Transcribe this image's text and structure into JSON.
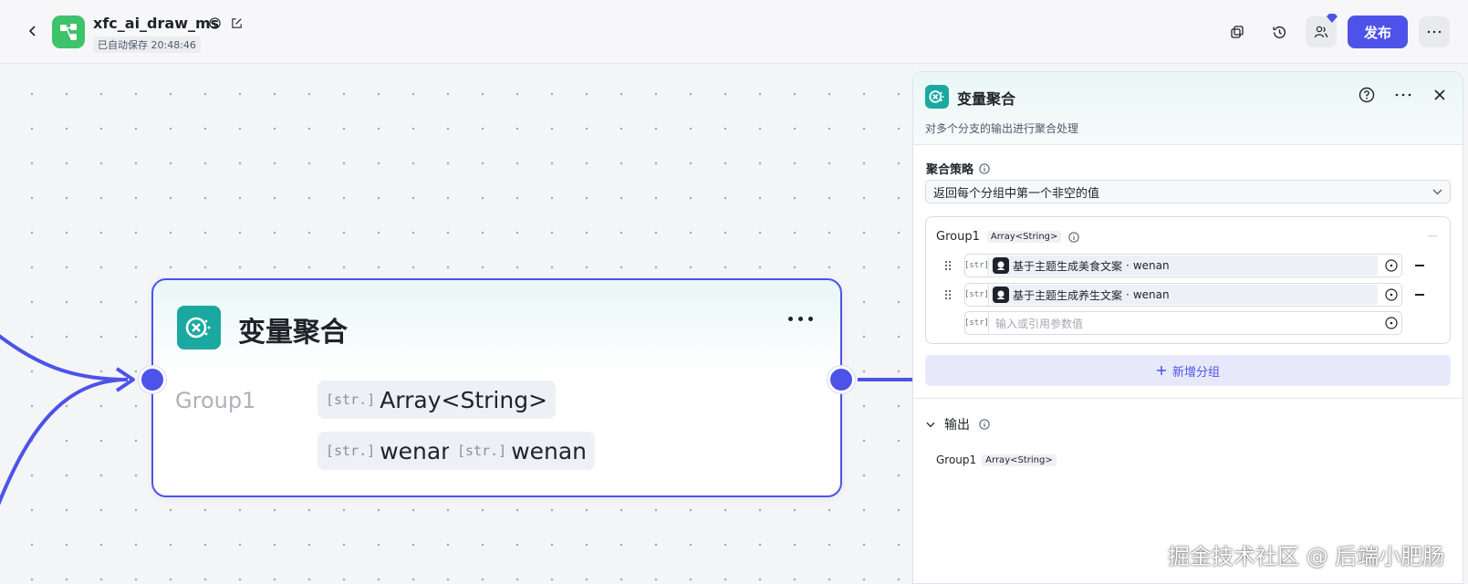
{
  "header": {
    "app_name": "xfc_ai_draw_ms",
    "save_status": "已自动保存 20:48:46",
    "publish_label": "发布",
    "brand_color": "#4d53e8",
    "logo_color": "#3ec26a"
  },
  "node": {
    "title": "变量聚合",
    "group_label": "Group1",
    "type_prefix": "[str.]",
    "type_label": "Array<String>",
    "vars": [
      "wenan",
      "wenan"
    ],
    "accent_color": "#1aa9a1"
  },
  "panel": {
    "title": "变量聚合",
    "description": "对多个分支的输出进行聚合处理",
    "strategy_label": "聚合策略",
    "strategy_value": "返回每个分组中第一个非空的值",
    "group": {
      "name": "Group1",
      "type": "Array<String>",
      "type_prefix": "[str]",
      "rows": [
        {
          "source": "基于主题生成美食文案",
          "var": "wenan"
        },
        {
          "source": "基于主题生成养生文案",
          "var": "wenan"
        }
      ],
      "placeholder": "输入或引用参数值"
    },
    "add_group_label": "新增分组",
    "output_label": "输出",
    "output": {
      "name": "Group1",
      "type": "Array<String>"
    }
  },
  "watermark": "掘金技术社区 @ 后端小肥肠"
}
